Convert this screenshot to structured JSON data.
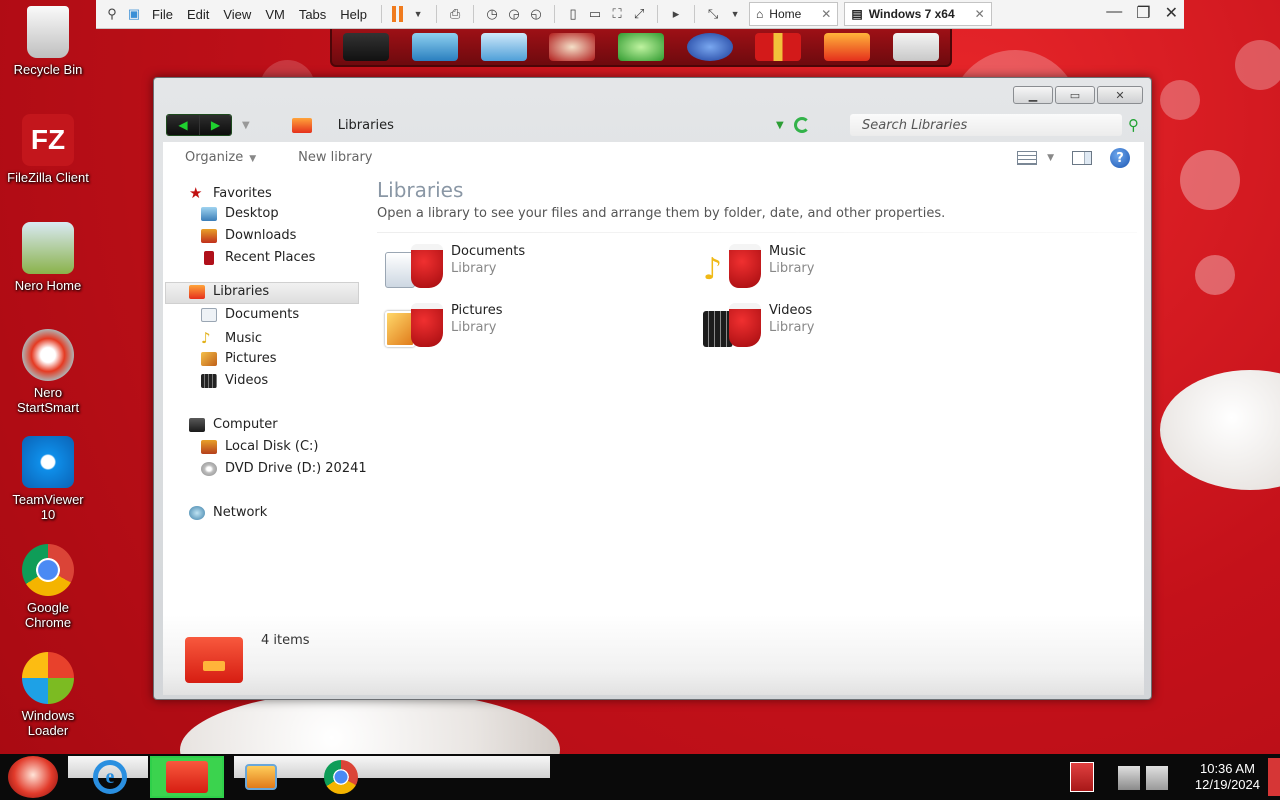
{
  "vmware": {
    "menus": [
      "File",
      "Edit",
      "View",
      "VM",
      "Tabs",
      "Help"
    ],
    "tabs": [
      {
        "label": "Home",
        "active": false
      },
      {
        "label": "Windows 7 x64",
        "active": true
      }
    ]
  },
  "desktop": {
    "icons": [
      {
        "label": "Recycle Bin",
        "icon": "recycle-bin-icon"
      },
      {
        "label": "FileZilla Client",
        "icon": "filezilla-icon"
      },
      {
        "label": "Nero Home",
        "icon": "nero-home-icon"
      },
      {
        "label": "Nero StartSmart",
        "icon": "nero-startsmart-icon"
      },
      {
        "label": "TeamViewer 10",
        "icon": "teamviewer-icon"
      },
      {
        "label": "Google Chrome",
        "icon": "chrome-icon"
      },
      {
        "label": "Windows Loader",
        "icon": "windows-loader-icon"
      }
    ]
  },
  "explorer": {
    "address": "Libraries",
    "search_placeholder": "Search Libraries",
    "commands": {
      "organize": "Organize",
      "new_library": "New library"
    },
    "nav": {
      "favorites": "Favorites",
      "favorites_items": [
        "Desktop",
        "Downloads",
        "Recent Places"
      ],
      "libraries": "Libraries",
      "libraries_items": [
        "Documents",
        "Music",
        "Pictures",
        "Videos"
      ],
      "computer": "Computer",
      "computer_items": [
        "Local Disk (C:)",
        "DVD Drive (D:) 20241"
      ],
      "network": "Network"
    },
    "header": {
      "title": "Libraries",
      "subtitle": "Open a library to see your files and arrange them by folder, date, and other properties."
    },
    "libraries": [
      {
        "name": "Documents",
        "type": "Library"
      },
      {
        "name": "Music",
        "type": "Library"
      },
      {
        "name": "Pictures",
        "type": "Library"
      },
      {
        "name": "Videos",
        "type": "Library"
      }
    ],
    "details": {
      "count": "4 items"
    }
  },
  "taskbar": {
    "time": "10:36 AM",
    "date": "12/19/2024"
  },
  "colors": {
    "desktop_red": "#c4111a",
    "nav_green": "#1fd12f",
    "vm_pause_orange": "#f07b1e"
  }
}
